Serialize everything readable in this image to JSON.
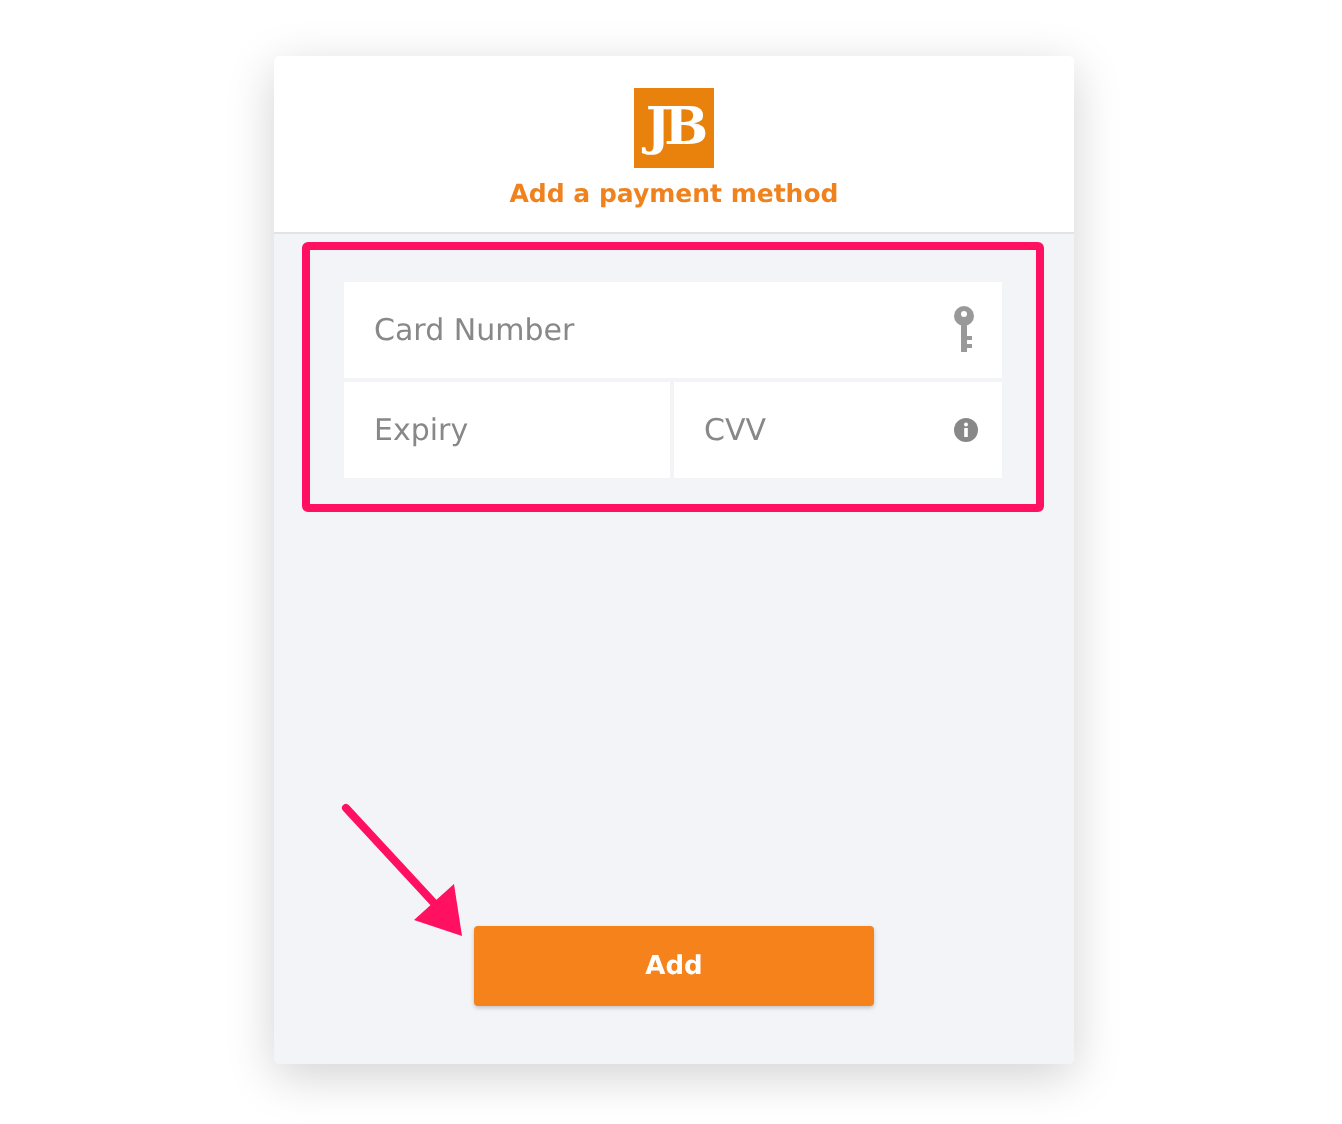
{
  "logo": {
    "text": "JB"
  },
  "header": {
    "title": "Add a payment method"
  },
  "form": {
    "fields": [
      {
        "kind": "card",
        "placeholder": "Card Number"
      },
      {
        "kind": "expiry",
        "placeholder": "Expiry"
      },
      {
        "kind": "cvv",
        "placeholder": "CVV"
      }
    ]
  },
  "highlight": true,
  "button": {
    "label": "Add"
  }
}
